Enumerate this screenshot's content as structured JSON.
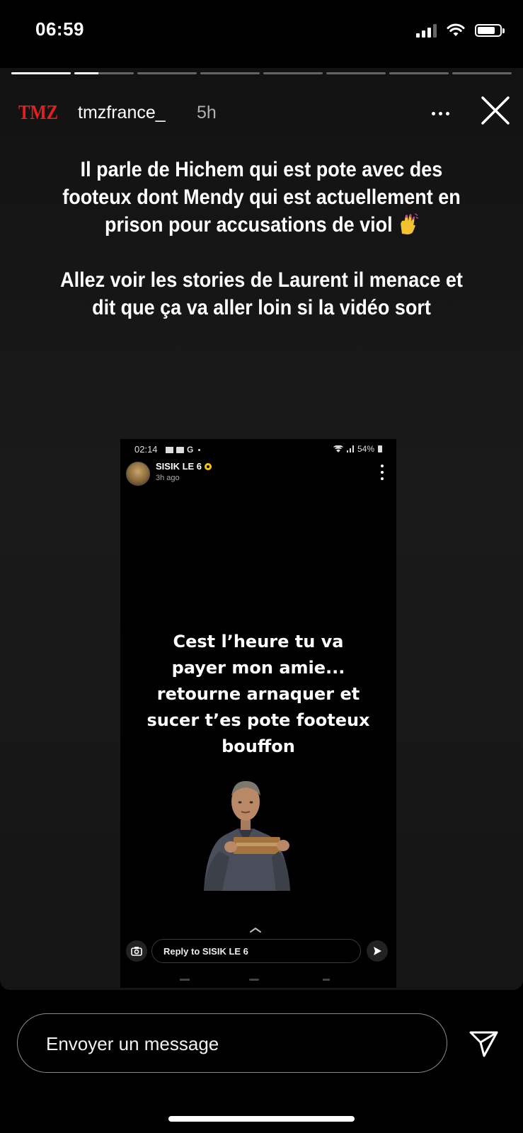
{
  "status_bar": {
    "time": "06:59"
  },
  "story": {
    "progress_segment_count": 8,
    "progress_active_fraction": 0.4,
    "account": {
      "logo_text": "TMZ",
      "username": "tmzfrance_",
      "time_ago": "5h"
    },
    "caption": {
      "paragraph1": "Il parle de Hichem qui est pote avec des footeux dont Mendy qui est actuellement en prison pour accusations de viol",
      "emoji": "nail-polish-emoji",
      "paragraph2": "Allez voir les stories de Laurent il menace et dit que ça va aller loin si la vidéo sort"
    },
    "embedded_screenshot": {
      "status_time": "02:14",
      "status_letter": "G",
      "battery": "54%",
      "poster_name": "SISIK LE 6",
      "poster_time": "3h ago",
      "message_lines": [
        "Cest l’heure tu va",
        "payer mon amie...",
        "retourne arnaquer et",
        "sucer t’es pote footeux",
        "bouffon"
      ],
      "reply_placeholder": "Reply to SISIK LE 6"
    }
  },
  "bottom_bar": {
    "message_placeholder": "Envoyer un message"
  },
  "colors": {
    "background": "#000000",
    "story_background": "#151515",
    "tmz_red": "#e4201e",
    "badge_yellow": "#f7c600",
    "text": "#ffffff",
    "muted_text": "#b0b0b0"
  },
  "icons": {
    "status": [
      "cellular-signal-icon",
      "wifi-icon",
      "battery-icon"
    ],
    "header": [
      "tmz-logo",
      "more-options-icon",
      "close-icon"
    ],
    "embed": [
      "avatar",
      "verified-badge-icon",
      "kebab-menu-icon",
      "chevron-up-icon",
      "camera-icon",
      "send-arrow-icon"
    ],
    "bottom": [
      "direct-send-icon"
    ]
  }
}
